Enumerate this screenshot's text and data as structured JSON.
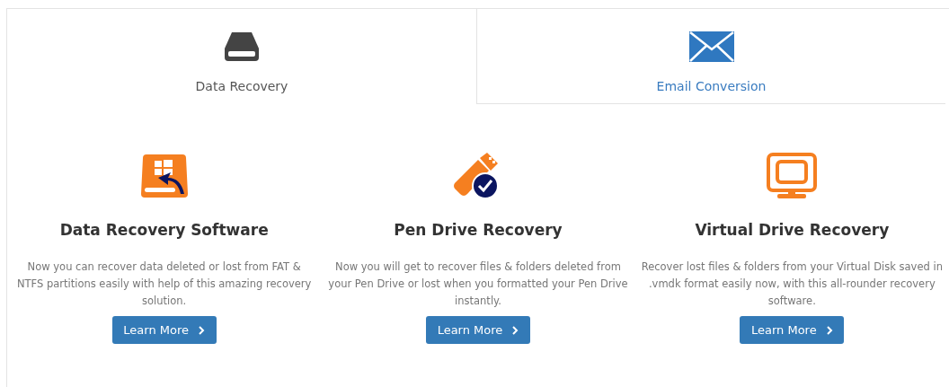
{
  "tabs": [
    {
      "label": "Data Recovery",
      "kind": "drive",
      "selected": true
    },
    {
      "label": "Email Conversion",
      "kind": "mail",
      "selected": false
    }
  ],
  "products": [
    {
      "kind": "restore",
      "title": "Data Recovery Software",
      "description": "Now you can recover data deleted or lost from FAT & NTFS partitions easily with help of this amazing recovery solution.",
      "button": "Learn More"
    },
    {
      "kind": "usb",
      "title": "Pen Drive Recovery",
      "description": "Now you will get to recover files & folders deleted from your Pen Drive or lost when you formatted your Pen Drive instantly.",
      "button": "Learn More"
    },
    {
      "kind": "monitor",
      "title": "Virtual Drive Recovery",
      "description": "Recover lost files & folders from your Virtual Disk saved in .vmdk format easily now, with this all-rounder recovery software.",
      "button": "Learn More"
    }
  ]
}
